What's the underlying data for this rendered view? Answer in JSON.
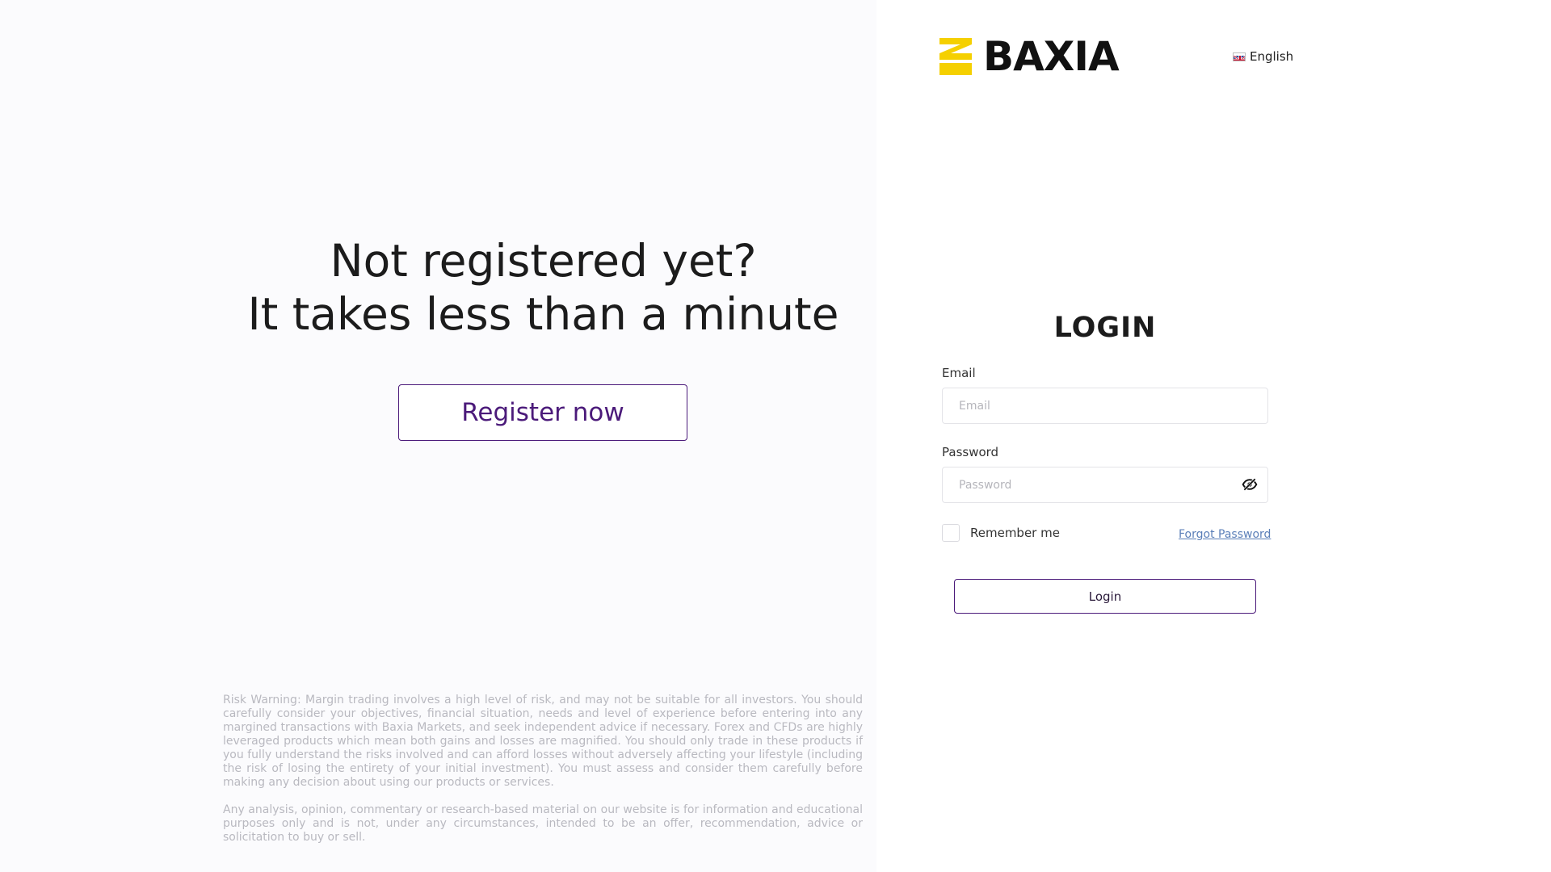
{
  "brand": {
    "name": "BAXIA",
    "mark_color": "#F5D000",
    "accent": "#4B1A7A"
  },
  "language": {
    "label": "English",
    "icon": "uk-flag-icon"
  },
  "promo": {
    "line1": "Not registered yet?",
    "line2": "It takes less than a minute",
    "register_label": "Register now"
  },
  "disclaimer": {
    "risk_warning": "Risk Warning: Margin trading involves a high level of risk, and may not be suitable for all investors. You should carefully consider your objectives, financial situation, needs and level of experience before entering into any margined transactions with Baxia Markets, and seek independent advice if necessary. Forex and CFDs are highly leveraged products which mean both gains and losses are magnified. You should only trade in these products if you fully understand the risks involved and can afford losses without adversely affecting your lifestyle (including the risk of losing the entirety of your initial investment). You must assess and consider them carefully before making any decision about using our products or services.",
    "analysis_notice": "Any analysis, opinion, commentary or research-based material on our website is for information and educational purposes only and is not, under any circumstances, intended to be an offer, recommendation, advice or solicitation to buy or sell."
  },
  "login": {
    "title": "LOGIN",
    "email_label": "Email",
    "email_placeholder": "Email",
    "email_value": "",
    "password_label": "Password",
    "password_placeholder": "Password",
    "password_value": "",
    "password_toggle_icon": "eye-slash-icon",
    "remember_label": "Remember me",
    "remember_checked": false,
    "forgot_label": "Forgot Password",
    "submit_label": "Login"
  }
}
